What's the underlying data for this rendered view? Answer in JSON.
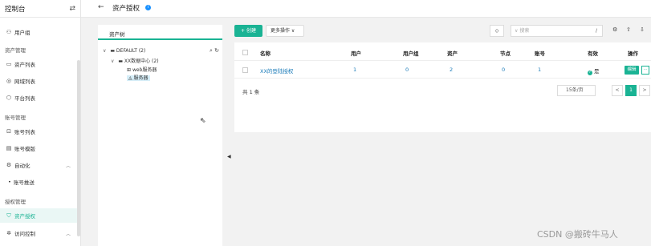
{
  "sidebar": {
    "title": "控制台",
    "toggle": "⇄",
    "items": {
      "user_group": "用户组",
      "section_assets": "资产管理",
      "asset_list": "资产列表",
      "domain_list": "网域列表",
      "platform_list": "平台列表",
      "section_accounts": "账号管理",
      "account_list": "账号列表",
      "account_template": "账号模版",
      "automation": "自动化",
      "account_push": "账号推送",
      "section_perms": "授权管理",
      "asset_perm": "资产授权",
      "access_control": "访问控制"
    }
  },
  "header": {
    "back": "←",
    "title": "资产授权",
    "info": "i"
  },
  "tree": {
    "tab": "资产树",
    "nodes": {
      "default": "DEFAULT (2)",
      "dc": "XX数据中心 (2)",
      "web": "web服务器",
      "server": "服务器"
    }
  },
  "toolbar": {
    "create": "+ 创建",
    "more": "更多操作 ∨",
    "search_placeholder": "搜索",
    "slash": "/"
  },
  "table": {
    "headers": [
      "名称",
      "用户",
      "用户组",
      "资产",
      "节点",
      "账号",
      "有效",
      "操作"
    ],
    "rows": [
      {
        "name": "XX的登陆授权",
        "users": "1",
        "user_groups": "0",
        "assets": "2",
        "nodes": "0",
        "accounts": "1",
        "valid": "是",
        "action": "编辑",
        "more": "···"
      }
    ],
    "total": "共 1 条",
    "page_size": "15条/页",
    "prev": "<",
    "page": "1",
    "next": ">"
  },
  "watermark": "CSDN @搬砖牛马人"
}
